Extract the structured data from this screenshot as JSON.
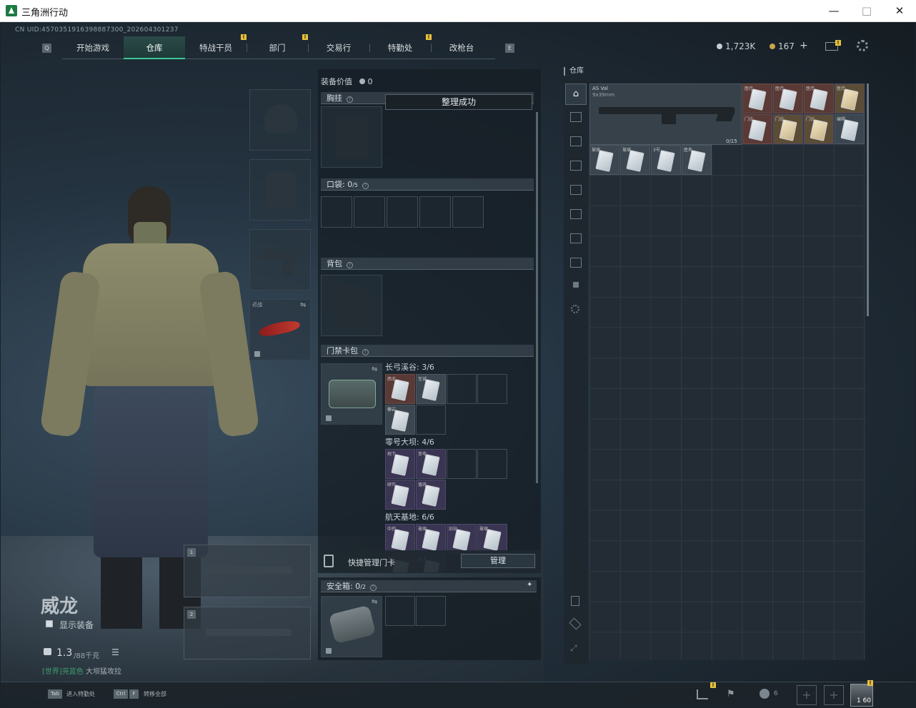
{
  "window": {
    "title": "三角洲行动",
    "controls": [
      "—",
      "□",
      "✕"
    ]
  },
  "uid": "CN UID:4570351916398887300_202604301237",
  "tabs": [
    {
      "label": "开始游戏",
      "active": false,
      "badge": false
    },
    {
      "label": "仓库",
      "active": true,
      "badge": false
    },
    {
      "label": "特战干员",
      "active": false,
      "badge": true
    },
    {
      "label": "部门",
      "active": false,
      "badge": true
    },
    {
      "label": "交易行",
      "active": false,
      "badge": false
    },
    {
      "label": "特勤处",
      "active": false,
      "badge": true
    },
    {
      "label": "改枪台",
      "active": false,
      "badge": false
    }
  ],
  "tab_keys": {
    "left": "Q",
    "right": "E"
  },
  "currency": {
    "hafu": "1,723K",
    "coupon": "167",
    "plus": "+"
  },
  "badge_mark": "!",
  "operator": {
    "name": "威龙",
    "show_gear_label": "显示装备",
    "weight": "1.3",
    "weight_unit": "/88千克"
  },
  "chat": {
    "channel": "[世界]",
    "user": "亮蓝色",
    "message": "大坝猛攻拉"
  },
  "hotkeys": [
    {
      "key": "Tab",
      "label": "进入特勤处"
    },
    {
      "key1": "Ctrl",
      "key2": "F",
      "label": "转移全部"
    }
  ],
  "equipment_panel": {
    "value_label": "装备价值",
    "value": "0",
    "chest_rig": "胸挂",
    "toast": "整理成功",
    "pocket_label": "口袋:",
    "pocket_count": "0",
    "pocket_cap": "/5",
    "backpack": "背包",
    "keycard_bag": "门禁卡包",
    "maps": [
      {
        "name": "长弓溪谷:",
        "count": "3/6",
        "cards": [
          {
            "lb": "西北"
          },
          {
            "lb": "至诚"
          },
          {
            "lb": "攀岩"
          }
        ]
      },
      {
        "name": "零号大坝:",
        "count": "4/6",
        "cards": [
          {
            "lb": "地下"
          },
          {
            "lb": "变电"
          },
          {
            "lb": "研究"
          },
          {
            "lb": "值班"
          }
        ]
      },
      {
        "name": "航天基地:",
        "count": "6/6",
        "cards": [
          {
            "lb": "中控"
          },
          {
            "lb": "玻璃"
          },
          {
            "lb": "旧站"
          },
          {
            "lb": "玻璃"
          },
          {
            "lb": "总裁"
          },
          {
            "lb": "离子"
          }
        ]
      }
    ],
    "quick_manage_label": "快捷管理门卡",
    "manage_button": "管理",
    "safebox_label": "安全箱:",
    "safebox_count": "0",
    "safebox_cap": "/2",
    "melee_label": "近战",
    "slot_numbers": [
      "1",
      "2"
    ]
  },
  "stash": {
    "title": "仓库",
    "weapon_name": "AS Val",
    "weapon_ammo": "9x39mm",
    "weapon_count": "0/15",
    "keycards_right": [
      {
        "lb": "医疗",
        "tone": "red"
      },
      {
        "lb": "医疗",
        "tone": "red"
      },
      {
        "lb": "医疗",
        "tone": "red"
      },
      {
        "lb": "医疗",
        "tone": "gold"
      },
      {
        "lb": "门诊",
        "tone": "red"
      },
      {
        "lb": "门诊",
        "tone": "gold"
      },
      {
        "lb": "门诊",
        "tone": "gold"
      },
      {
        "lb": "编辑",
        "tone": "gray"
      }
    ],
    "keycards_row2": [
      {
        "lb": "玻璃"
      },
      {
        "lb": "玻璃"
      },
      {
        "lb": "3号"
      },
      {
        "lb": "医务"
      }
    ]
  },
  "bottom_bar": {
    "friends": "6",
    "avatar_level": "1 60"
  }
}
